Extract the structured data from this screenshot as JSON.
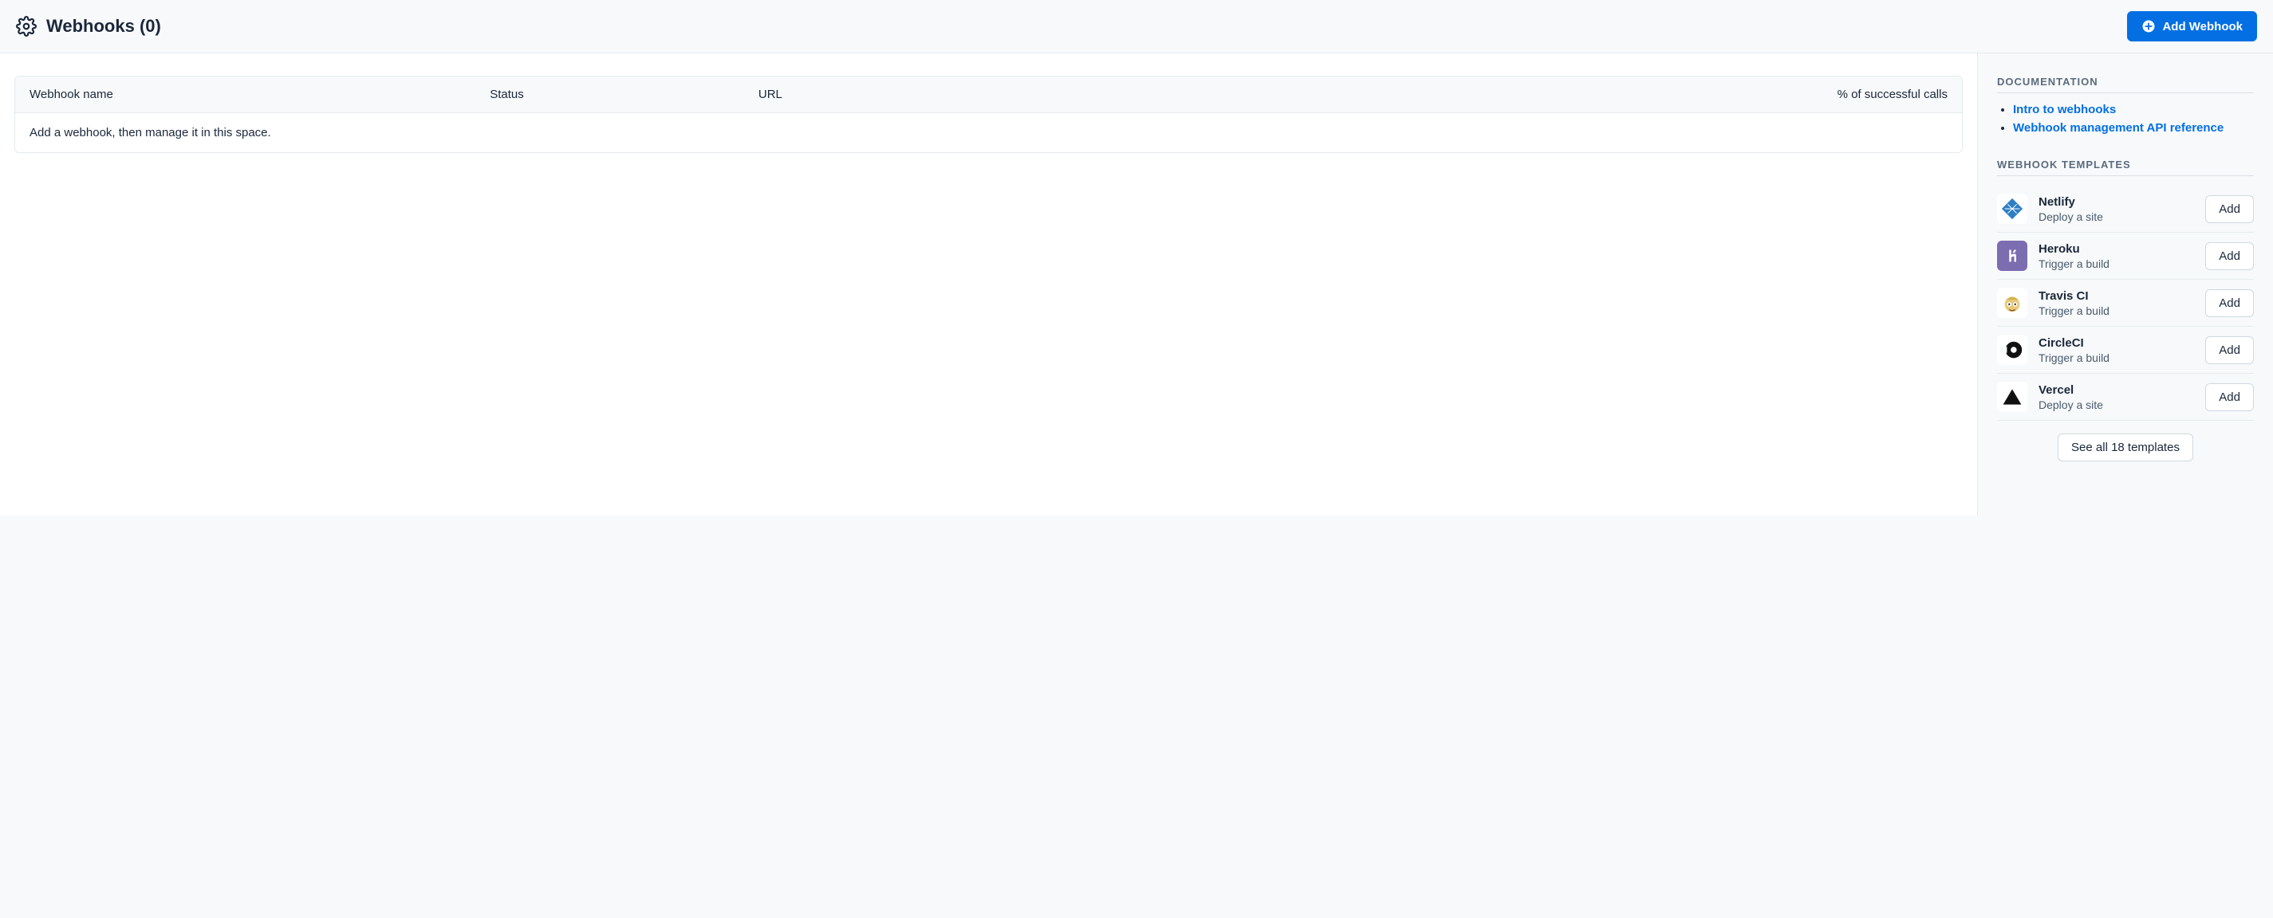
{
  "header": {
    "title": "Webhooks (0)",
    "addButton": "Add Webhook"
  },
  "table": {
    "columns": {
      "name": "Webhook name",
      "status": "Status",
      "url": "URL",
      "pct": "% of successful calls"
    },
    "emptyMessage": "Add a webhook, then manage it in this space."
  },
  "sidebar": {
    "docTitle": "DOCUMENTATION",
    "docLinks": [
      "Intro to webhooks",
      "Webhook management API reference"
    ],
    "templatesTitle": "WEBHOOK TEMPLATES",
    "templates": [
      {
        "name": "Netlify",
        "desc": "Deploy a site",
        "addLabel": "Add"
      },
      {
        "name": "Heroku",
        "desc": "Trigger a build",
        "addLabel": "Add"
      },
      {
        "name": "Travis CI",
        "desc": "Trigger a build",
        "addLabel": "Add"
      },
      {
        "name": "CircleCI",
        "desc": "Trigger a build",
        "addLabel": "Add"
      },
      {
        "name": "Vercel",
        "desc": "Deploy a site",
        "addLabel": "Add"
      }
    ],
    "seeAll": "See all 18 templates"
  }
}
